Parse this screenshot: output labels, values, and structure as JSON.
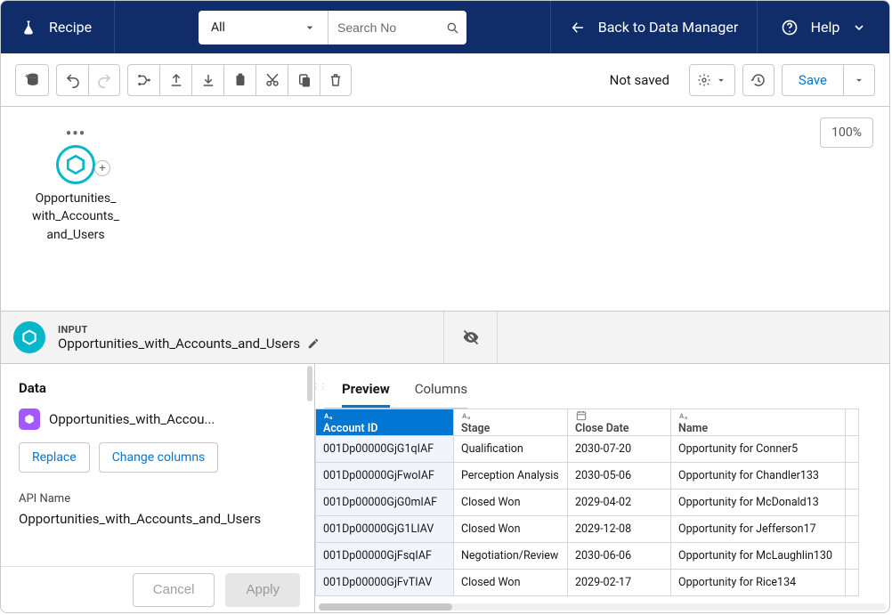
{
  "navbar": {
    "recipe": "Recipe",
    "filter_selected": "All",
    "search_placeholder": "Search No",
    "back_label": "Back to Data Manager",
    "help_label": "Help"
  },
  "toolbar": {
    "status": "Not saved",
    "save_label": "Save"
  },
  "canvas": {
    "zoom": "100%",
    "node_label_l1": "Opportunities_",
    "node_label_l2": "with_Accounts_",
    "node_label_l3": "and_Users"
  },
  "input_header": {
    "label": "INPUT",
    "name": "Opportunities_with_Accounts_and_Users"
  },
  "side": {
    "data_heading": "Data",
    "source_display": "Opportunities_with_Accou...",
    "replace_btn": "Replace",
    "change_cols_btn": "Change columns",
    "api_name_label": "API Name",
    "api_name_value": "Opportunities_with_Accounts_and_Users",
    "cancel_btn": "Cancel",
    "apply_btn": "Apply"
  },
  "tabs": {
    "preview": "Preview",
    "columns": "Columns"
  },
  "table": {
    "columns": [
      {
        "type": "text",
        "label": "Account ID"
      },
      {
        "type": "text",
        "label": "Stage"
      },
      {
        "type": "date",
        "label": "Close Date"
      },
      {
        "type": "text",
        "label": "Name"
      }
    ],
    "rows": [
      {
        "id": "001Dp00000GjG1qIAF",
        "stage": "Qualification",
        "close": "2030-07-20",
        "name": "Opportunity for Conner5"
      },
      {
        "id": "001Dp00000GjFwoIAF",
        "stage": "Perception Analysis",
        "close": "2030-05-06",
        "name": "Opportunity for Chandler133"
      },
      {
        "id": "001Dp00000GjG0mIAF",
        "stage": "Closed Won",
        "close": "2029-04-02",
        "name": "Opportunity for McDonald13"
      },
      {
        "id": "001Dp00000GjG1LIAV",
        "stage": "Closed Won",
        "close": "2029-12-08",
        "name": "Opportunity for Jefferson17"
      },
      {
        "id": "001Dp00000GjFsqIAF",
        "stage": "Negotiation/Review",
        "close": "2030-06-06",
        "name": "Opportunity for McLaughlin130"
      },
      {
        "id": "001Dp00000GjFvTIAV",
        "stage": "Closed Won",
        "close": "2029-02-17",
        "name": "Opportunity for Rice134"
      }
    ]
  }
}
